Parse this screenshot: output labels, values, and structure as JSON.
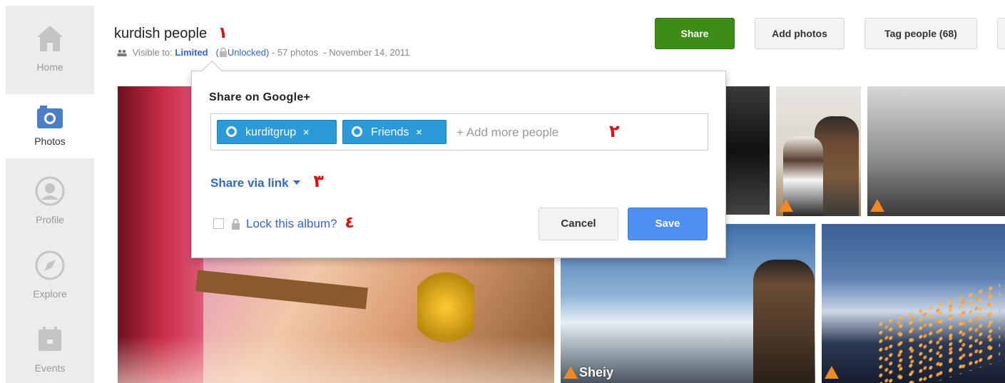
{
  "sidebar": {
    "items": [
      {
        "label": "Home",
        "icon": "home-icon"
      },
      {
        "label": "Photos",
        "icon": "camera-icon",
        "active": true
      },
      {
        "label": "Profile",
        "icon": "profile-icon"
      },
      {
        "label": "Explore",
        "icon": "compass-icon"
      },
      {
        "label": "Events",
        "icon": "calendar-icon"
      }
    ]
  },
  "album": {
    "title": "kurdish people",
    "visible_prefix": "Visible to:",
    "visibility": "Limited",
    "open_paren": "(",
    "unlocked": "Unlocked)",
    "photo_count": "- 57 photos",
    "date": "- November 14, 2011"
  },
  "annotations": [
    "١",
    "٢",
    "٣",
    "٤"
  ],
  "toolbar": {
    "share": "Share",
    "add_photos": "Add photos",
    "tag_people": "Tag people (68)"
  },
  "dialog": {
    "title": "Share on Google+",
    "chips": [
      {
        "label": "kurditgrup",
        "remove": "×"
      },
      {
        "label": "Friends",
        "remove": "×"
      }
    ],
    "placeholder": "+ Add more people",
    "share_via_link": "Share via link",
    "lock_label": "Lock this album?",
    "cancel": "Cancel",
    "save": "Save"
  },
  "watermark": "Sheiy",
  "colors": {
    "share_green": "#3d8c17",
    "save_blue": "#4e8ff2",
    "chip_blue": "#2b9ad6",
    "link_blue": "#3567c7",
    "annotation_red": "#dd1111"
  }
}
